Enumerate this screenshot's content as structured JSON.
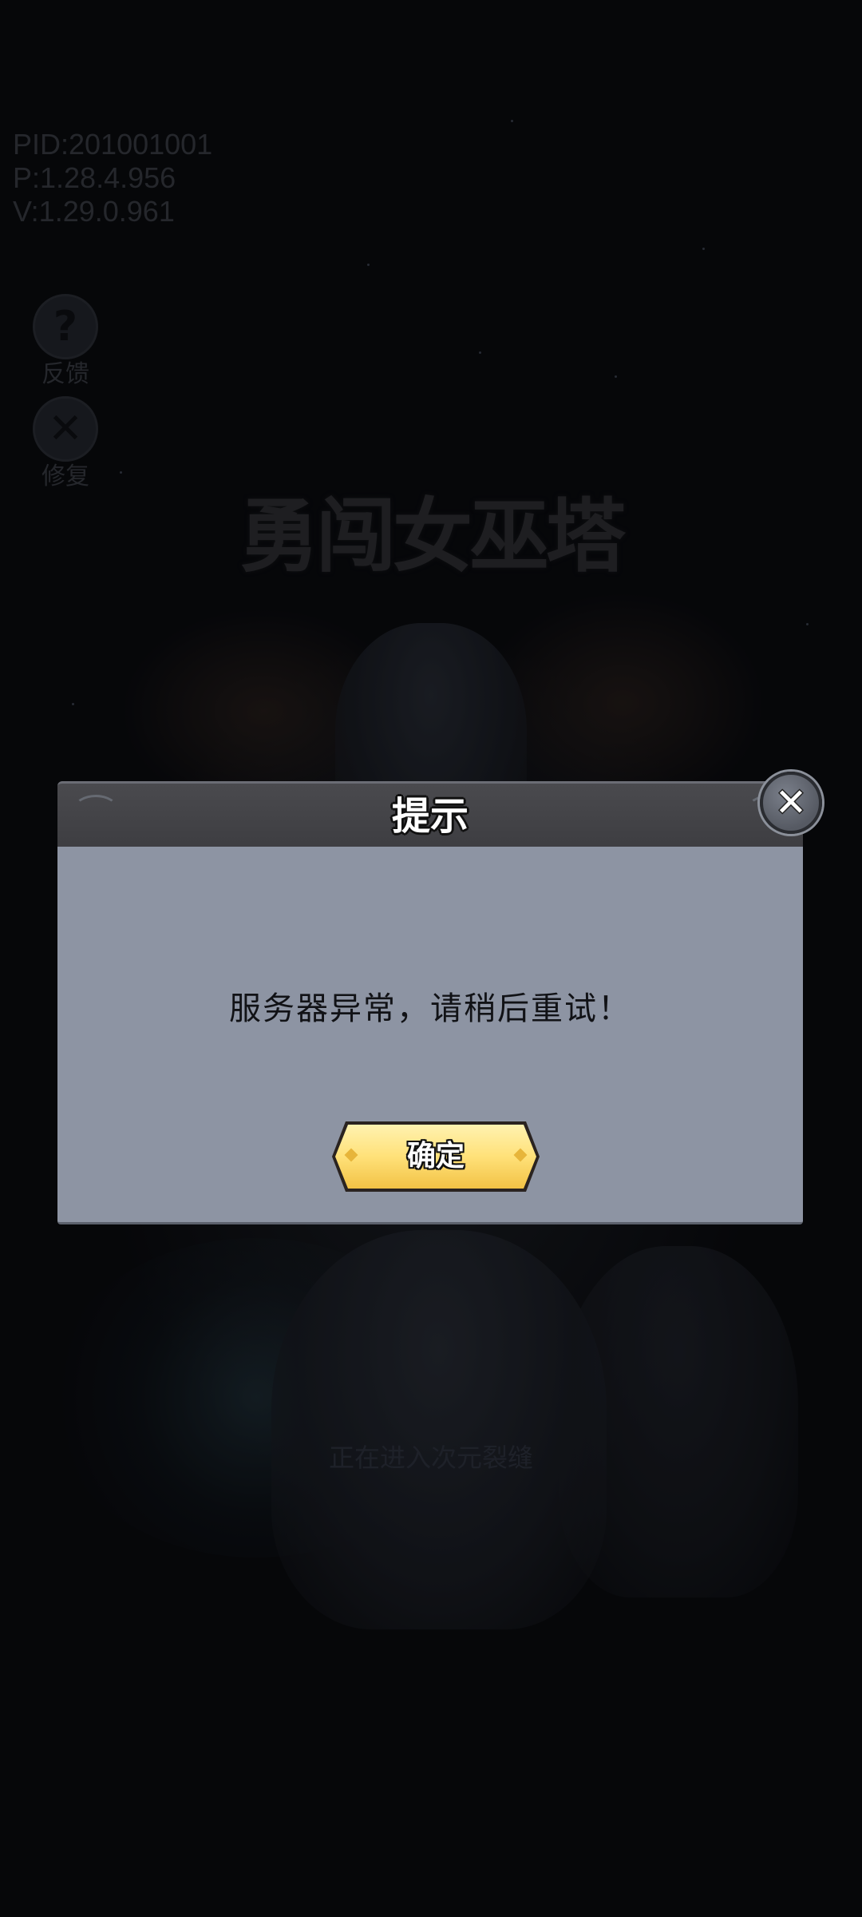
{
  "version_info": {
    "pid": "PID:201001001",
    "p": "P:1.28.4.956",
    "v": "V:1.29.0.961"
  },
  "side_buttons": {
    "feedback": {
      "icon": "?",
      "label": "反馈"
    },
    "repair": {
      "icon": "✕",
      "label": "修复"
    }
  },
  "game_logo": {
    "text": "勇闯女巫塔"
  },
  "loading_text": "正在进入次元裂缝",
  "dialog": {
    "title": "提示",
    "message": "服务器异常，请稍后重试！",
    "confirm_label": "确定",
    "close_icon": "close-icon",
    "colors": {
      "header": "#3d3d41",
      "body": "#8d94a3",
      "button": "#ffe179"
    }
  }
}
